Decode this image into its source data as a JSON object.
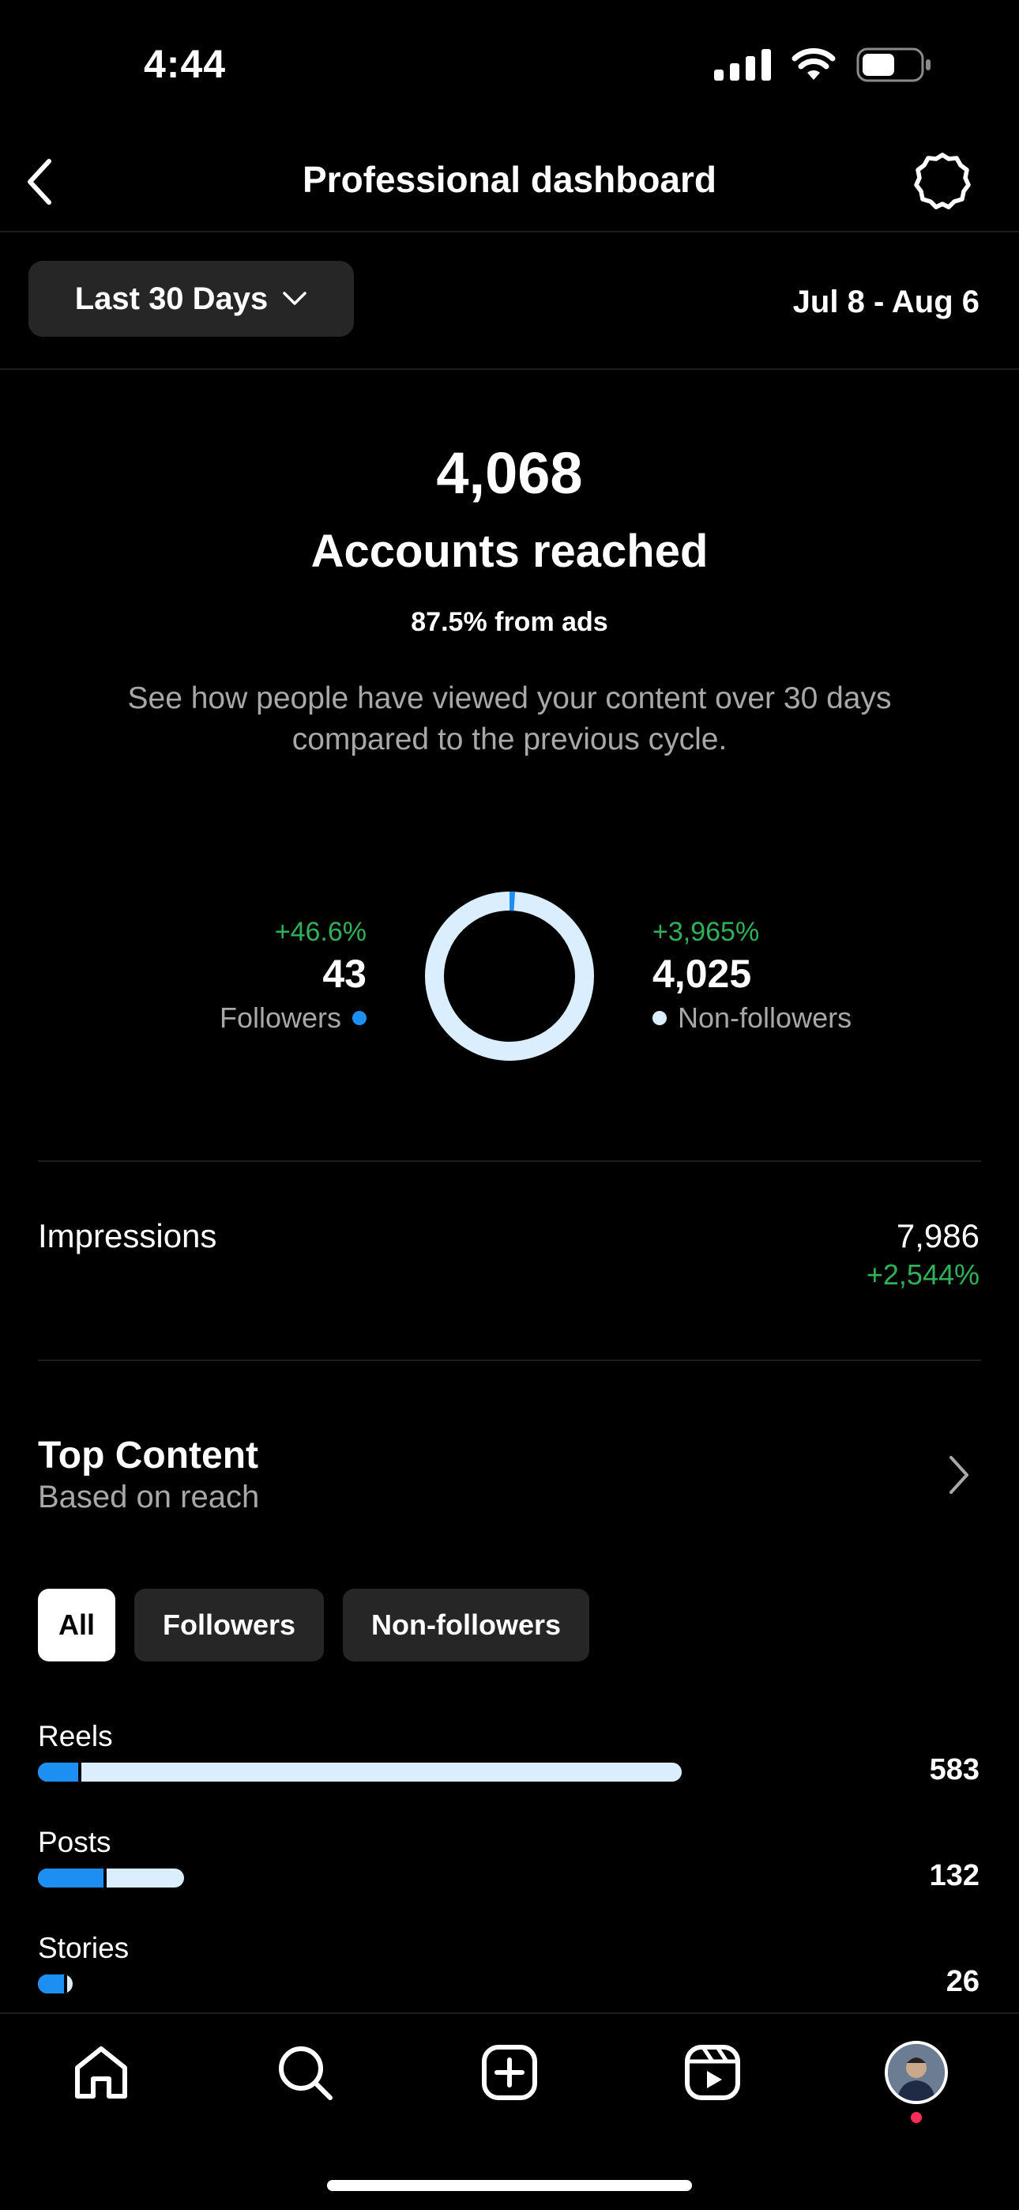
{
  "status_bar": {
    "time": "4:44"
  },
  "header": {
    "title": "Professional dashboard"
  },
  "range": {
    "label": "Last 30 Days",
    "dates": "Jul 8 - Aug 6"
  },
  "reach": {
    "value": "4,068",
    "label": "Accounts reached",
    "ads_note": "87.5% from ads",
    "description": "See how people have viewed your content over 30 days compared to the previous cycle."
  },
  "audience": {
    "followers": {
      "change": "+46.6%",
      "value": "43",
      "label": "Followers",
      "color": "#1e8ff2"
    },
    "non_followers": {
      "change": "+3,965%",
      "value": "4,025",
      "label": "Non-followers",
      "color": "#dbeefd"
    },
    "followers_share": 0.0106
  },
  "impressions": {
    "label": "Impressions",
    "value": "7,986",
    "change": "+2,544%"
  },
  "top_content": {
    "title": "Top Content",
    "subtitle": "Based on reach",
    "filters": [
      "All",
      "Followers",
      "Non-followers"
    ],
    "active_filter": "All",
    "rows": [
      {
        "label": "Reels",
        "value": "583",
        "total": 583,
        "followers": 39
      },
      {
        "label": "Posts",
        "value": "132",
        "total": 132,
        "followers": 62
      },
      {
        "label": "Stories",
        "value": "26",
        "total": 26,
        "followers": 22
      }
    ],
    "max_value": 583
  },
  "nav": {
    "items": [
      "home-icon",
      "search-icon",
      "create-icon",
      "reels-icon",
      "profile-avatar"
    ]
  },
  "colors": {
    "positive": "#2fb15a",
    "followers": "#1e8ff2",
    "non_followers": "#dbeefd",
    "chip_bg": "#262626"
  }
}
